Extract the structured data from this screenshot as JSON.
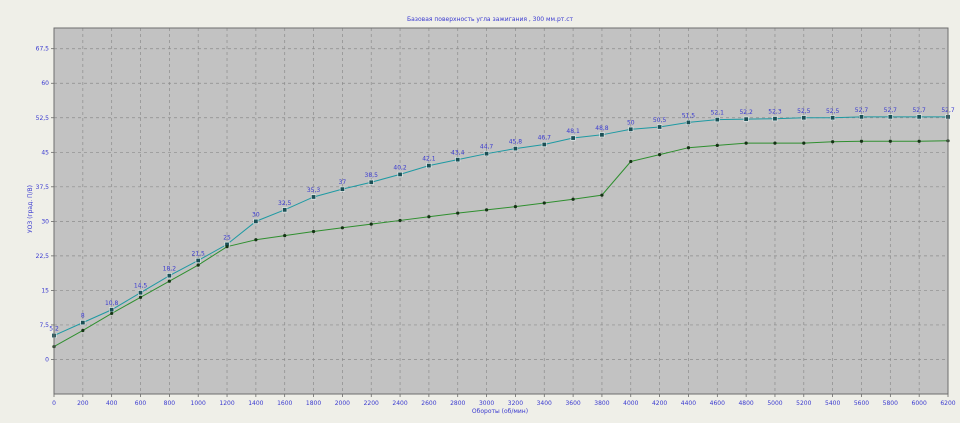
{
  "chart_data": {
    "type": "line",
    "title": "Базовая поверхность угла зажигания , 300 мм.рт.ст",
    "xlabel": "Обороты (об/мин)",
    "ylabel": "УОЗ (град. П/В)",
    "xlim": [
      0,
      6200
    ],
    "ylim": [
      -7.5,
      72
    ],
    "x_ticks": [
      0,
      200,
      400,
      600,
      800,
      1000,
      1200,
      1400,
      1600,
      1800,
      2000,
      2200,
      2400,
      2600,
      2800,
      3000,
      3200,
      3400,
      3600,
      3800,
      4000,
      4200,
      4400,
      4600,
      4800,
      5000,
      5200,
      5400,
      5600,
      5800,
      6000,
      6200
    ],
    "x_tick_labels": [
      "0",
      "200",
      "400",
      "600",
      "800",
      "1000",
      "1200",
      "1400",
      "1600",
      "1800",
      "2000",
      "2200",
      "2400",
      "2600",
      "2800",
      "3000",
      "3200",
      "3400",
      "3600",
      "3800",
      "4000",
      "4200",
      "4400",
      "4600",
      "4800",
      "5000",
      "5200",
      "5400",
      "5600",
      "5800",
      "6000",
      "6200"
    ],
    "y_ticks": [
      0,
      7.5,
      15,
      22.5,
      30,
      37.5,
      45,
      52.5,
      60,
      67.5
    ],
    "y_tick_labels": [
      "0",
      "7,5",
      "15",
      "22,5",
      "30",
      "37,5",
      "45",
      "52,5",
      "60",
      "67,5"
    ],
    "grid": true,
    "x": [
      0,
      200,
      400,
      600,
      800,
      1000,
      1200,
      1400,
      1600,
      1800,
      2000,
      2200,
      2400,
      2600,
      2800,
      3000,
      3200,
      3400,
      3600,
      3800,
      4000,
      4200,
      4400,
      4600,
      4800,
      5000,
      5200,
      5400,
      5600,
      5800,
      6000,
      6200
    ],
    "series": [
      {
        "color": "#1e9aa3",
        "marker": "square",
        "values": [
          5.2,
          8.0,
          10.8,
          14.5,
          18.2,
          21.5,
          25.0,
          30.0,
          32.5,
          35.3,
          37.0,
          38.5,
          40.2,
          42.1,
          43.4,
          44.7,
          45.8,
          46.7,
          48.1,
          48.8,
          50.0,
          50.5,
          51.5,
          52.1,
          52.2,
          52.3,
          52.5,
          52.5,
          52.7,
          52.7,
          52.7,
          52.7
        ],
        "labels": [
          "5,2",
          "8",
          "10,8",
          "14,5",
          "18,2",
          "21,5",
          "25",
          "30",
          "32,5",
          "35,3",
          "37",
          "38,5",
          "40,2",
          "42,1",
          "43,4",
          "44,7",
          "45,8",
          "46,7",
          "48,1",
          "48,8",
          "50",
          "50,5",
          "51,5",
          "52,1",
          "52,2",
          "52,3",
          "52,5",
          "52,5",
          "52,7",
          "52,7",
          "52,7",
          "52,7"
        ]
      },
      {
        "color": "#2f8f2f",
        "marker": "dot",
        "values": [
          2.8,
          6.3,
          10.0,
          13.5,
          17.0,
          20.5,
          24.5,
          26.0,
          26.9,
          27.8,
          28.6,
          29.4,
          30.2,
          31.0,
          31.8,
          32.5,
          33.2,
          34.0,
          34.8,
          35.7,
          43.0,
          44.5,
          46.0,
          46.5,
          47.0,
          47.0,
          47.0,
          47.3,
          47.4,
          47.4,
          47.4,
          47.5
        ]
      }
    ]
  },
  "colors": {
    "page_bg": "#efefe8",
    "plot_bg": "#c2c2c2",
    "grid": "#8c8c8c",
    "label_text": "#3a3ad0",
    "axis_text": "#3a3ad0"
  }
}
